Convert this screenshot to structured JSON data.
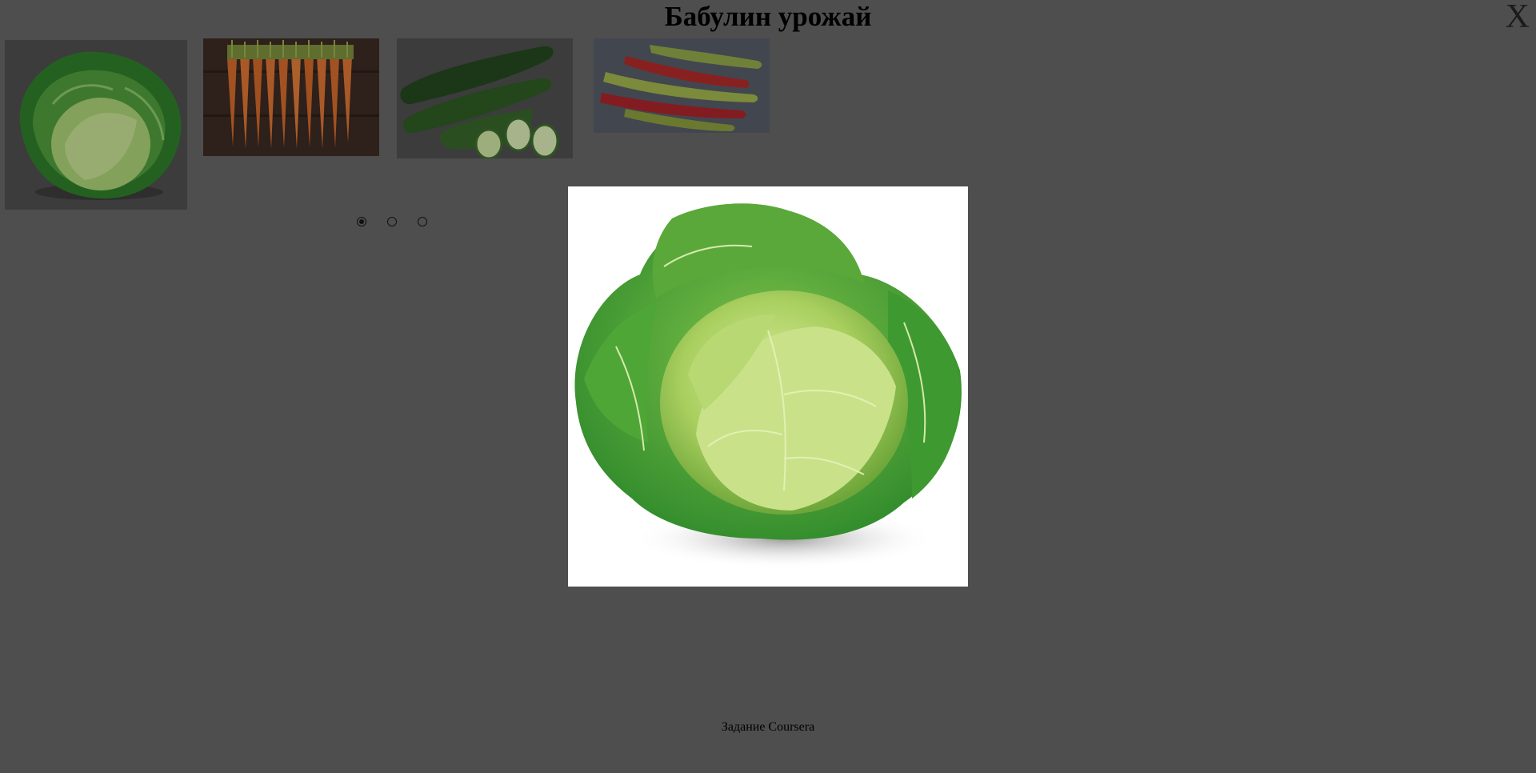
{
  "page": {
    "title": "Бабулин урожай",
    "close_label": "X",
    "footer_text": "Задание Coursera"
  },
  "gallery": {
    "thumbnails": [
      {
        "name": "cabbage",
        "icon": "cabbage-image"
      },
      {
        "name": "carrots",
        "icon": "carrots-image"
      },
      {
        "name": "cucumbers",
        "icon": "cucumbers-image"
      },
      {
        "name": "peppers",
        "icon": "peppers-image"
      }
    ],
    "dots": [
      {
        "index": 1,
        "selected": true
      },
      {
        "index": 2,
        "selected": false
      },
      {
        "index": 3,
        "selected": false
      }
    ],
    "main_image": {
      "name": "cabbage",
      "icon": "cabbage-image"
    }
  },
  "colors": {
    "overlay_background": "#4e4e4e",
    "main_image_background": "#ffffff"
  }
}
